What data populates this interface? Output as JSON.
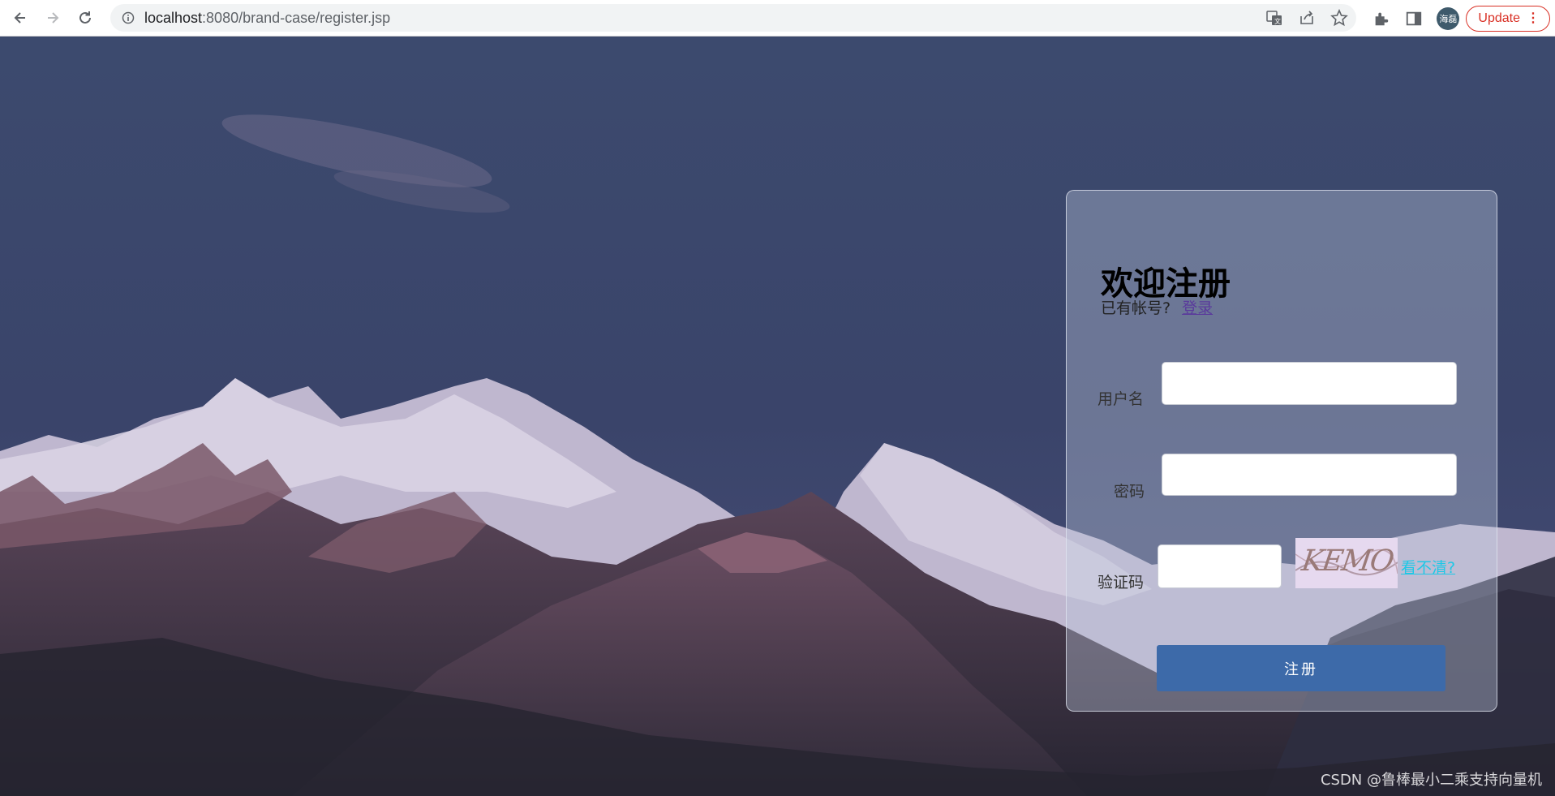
{
  "browser": {
    "url_host": "localhost",
    "url_rest": ":8080/brand-case/register.jsp",
    "profile_label": "海磊",
    "update_label": "Update",
    "icons": [
      "back-icon",
      "forward-icon",
      "reload-icon",
      "info-icon",
      "translate-icon",
      "share-icon",
      "star-icon",
      "extensions-icon",
      "side-panel-icon",
      "menu-icon"
    ]
  },
  "register": {
    "title": "欢迎注册",
    "has_account_text": "已有帐号?",
    "login_link": "登录",
    "username_label": "用户名",
    "password_label": "密码",
    "captcha_label": "验证码",
    "captcha_image_text": "KEMO",
    "captcha_refresh": "看不清?",
    "submit_label": "注册"
  },
  "watermark": "CSDN @鲁棒最小二乘支持向量机",
  "colors": {
    "sky": "#3a4566",
    "submit_button": "#3d6aa9",
    "refresh_link": "#1ec8e6",
    "update_button": "#d93025"
  }
}
